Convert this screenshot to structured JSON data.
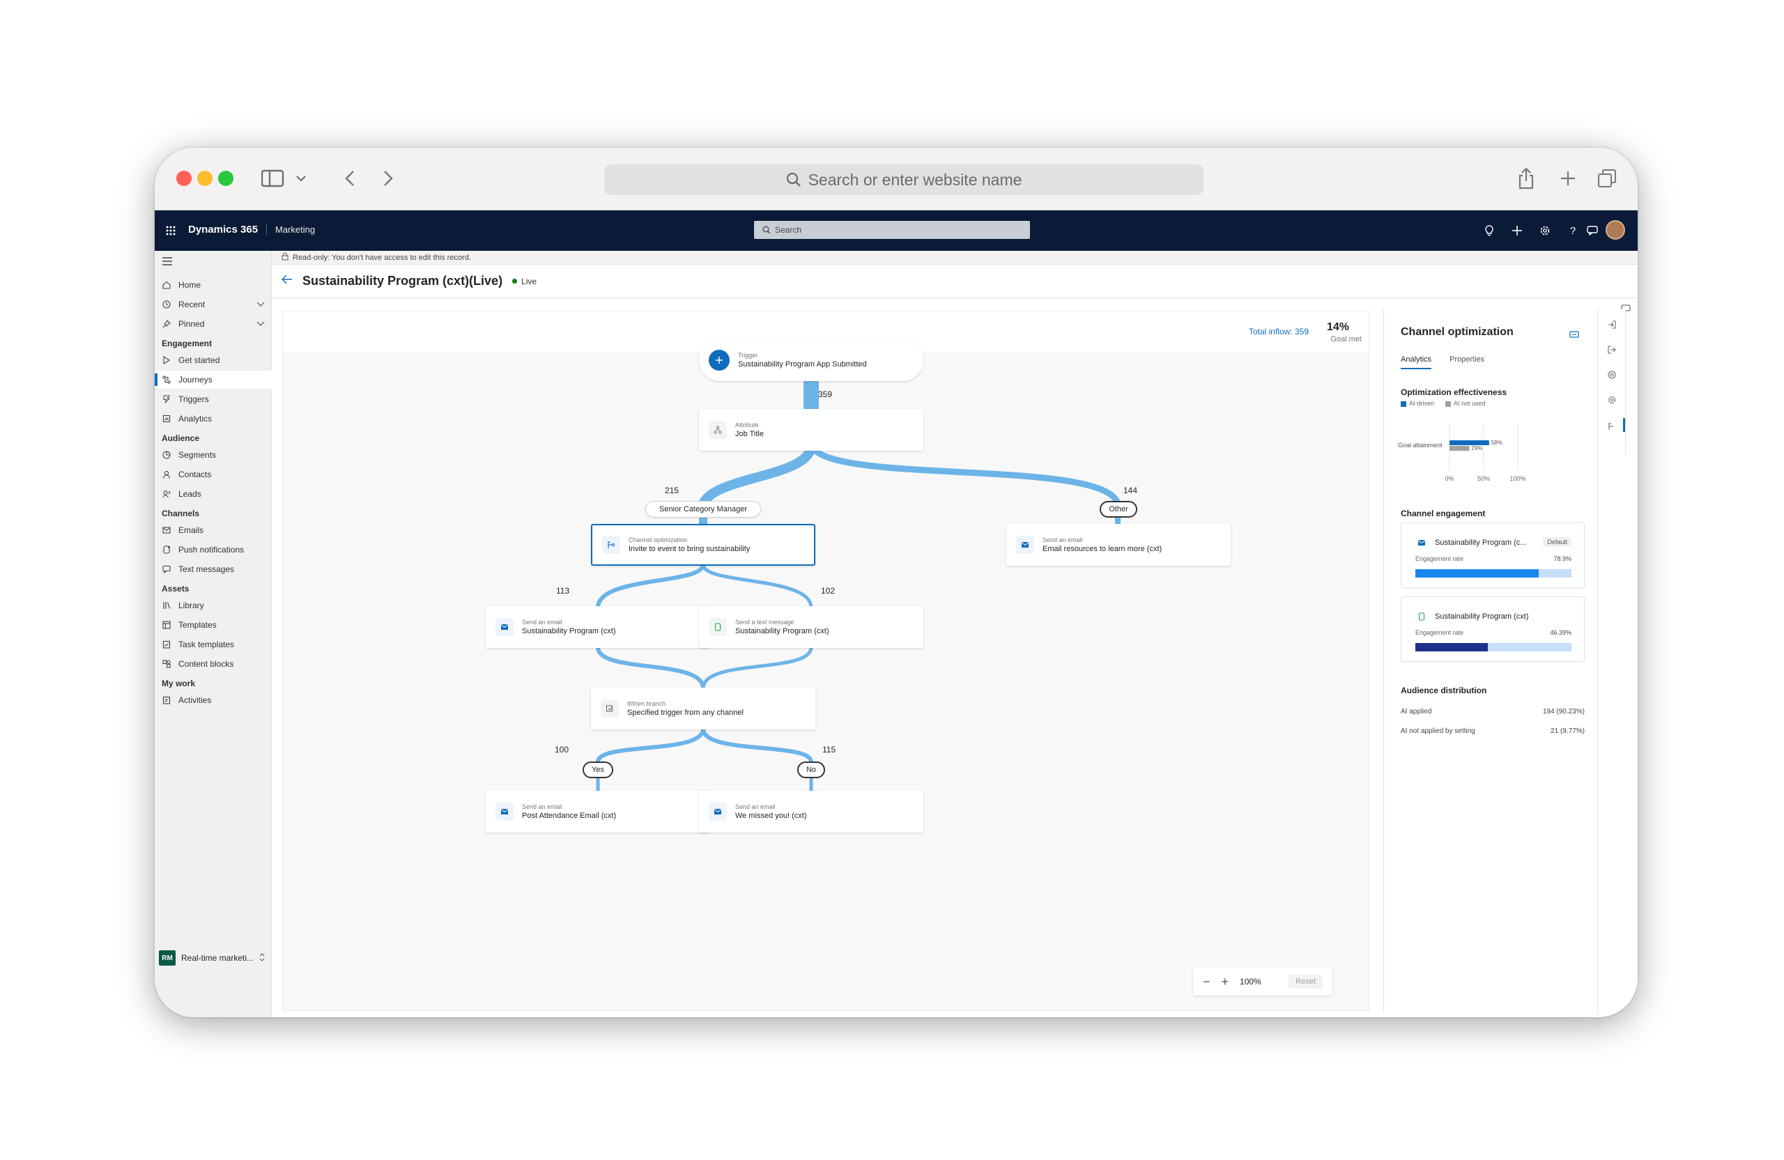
{
  "browser": {
    "url_placeholder": "Search or enter website name"
  },
  "appbar": {
    "brand": "Dynamics 365",
    "module": "Marketing",
    "search_placeholder": "Search"
  },
  "sidebar": {
    "top_items": [
      {
        "label": "Home",
        "icon": "home-icon"
      },
      {
        "label": "Recent",
        "icon": "clock-icon"
      },
      {
        "label": "Pinned",
        "icon": "pin-icon"
      }
    ],
    "sections": [
      {
        "title": "Engagement",
        "items": [
          "Get started",
          "Journeys",
          "Triggers",
          "Analytics"
        ]
      },
      {
        "title": "Audience",
        "items": [
          "Segments",
          "Contacts",
          "Leads"
        ]
      },
      {
        "title": "Channels",
        "items": [
          "Emails",
          "Push notifications",
          "Text messages"
        ]
      },
      {
        "title": "Assets",
        "items": [
          "Library",
          "Templates",
          "Task templates",
          "Content blocks"
        ]
      },
      {
        "title": "My work",
        "items": [
          "Activities"
        ]
      }
    ],
    "active_item": "Journeys",
    "area": {
      "badge": "RM",
      "label": "Real-time marketi..."
    }
  },
  "notice": "Read-only: You don't have access to edit this record.",
  "page": {
    "title": "Sustainability Program (cxt)(Live)",
    "status": "Live"
  },
  "canvas": {
    "total_inflow": "Total inflow: 359",
    "goal_pct": "14%",
    "goal_label": "Goal met",
    "zoom_level": "100%",
    "reset_label": "Reset"
  },
  "journey": {
    "trigger": {
      "label": "Trigger",
      "title": "Sustainability Program App Submitted"
    },
    "attribute": {
      "label": "Attribute",
      "title": "Job Title"
    },
    "channel_opt": {
      "label": "Channel optimization",
      "title": "Invite to event to bring sustainability"
    },
    "email_resources": {
      "label": "Send an email",
      "title": "Email resources to learn more (cxt)"
    },
    "email_program": {
      "label": "Send an email",
      "title": "Sustainability Program (cxt)"
    },
    "sms_program": {
      "label": "Send a text message",
      "title": "Sustainability Program (cxt)"
    },
    "ifthen": {
      "label": "If/then branch",
      "title": "Specified trigger from any channel"
    },
    "email_post": {
      "label": "Send an email",
      "title": "Post Attendance Email (cxt)"
    },
    "email_missed": {
      "label": "Send an email",
      "title": "We missed you! (cxt)"
    },
    "counts": {
      "c359": "359",
      "c215": "215",
      "c144": "144",
      "c113": "113",
      "c102": "102",
      "c100": "100",
      "c115": "115"
    },
    "pills": {
      "senior": "Senior Category Manager",
      "other": "Other",
      "yes": "Yes",
      "no": "No"
    }
  },
  "panel": {
    "title": "Channel optimization",
    "tabs": [
      "Analytics",
      "Properties"
    ],
    "effectiveness_title": "Optimization effectiveness",
    "legend": [
      {
        "label": "AI-driven",
        "color": "#0f6cbd"
      },
      {
        "label": "AI not used",
        "color": "#a0a0a0"
      }
    ],
    "chart_data": {
      "type": "bar",
      "categories": [
        "Goal attainment"
      ],
      "series": [
        {
          "name": "AI-driven",
          "values": [
            58
          ]
        },
        {
          "name": "AI not used",
          "values": [
            29
          ]
        }
      ],
      "value_labels": [
        "58%",
        "29%"
      ],
      "ticks": [
        "0%",
        "50%",
        "100%"
      ],
      "xlim": [
        0,
        100
      ]
    },
    "engagement_title": "Channel engagement",
    "engagement": [
      {
        "name": "Sustainability Program (c...",
        "badge": "Default",
        "rate_label": "Engagement rate",
        "rate": "78.9%",
        "rate_value": 78.9,
        "color": "#1a86f0"
      },
      {
        "name": "Sustainability Program (cxt)",
        "badge": "",
        "rate_label": "Engagement rate",
        "rate": "46.39%",
        "rate_value": 46.39,
        "color": "#1f2f8c"
      }
    ],
    "distribution_title": "Audience distribution",
    "distribution": [
      {
        "label": "AI applied",
        "value": "194 (90.23%)"
      },
      {
        "label": "AI not applied by setting",
        "value": "21 (9.77%)"
      }
    ]
  }
}
